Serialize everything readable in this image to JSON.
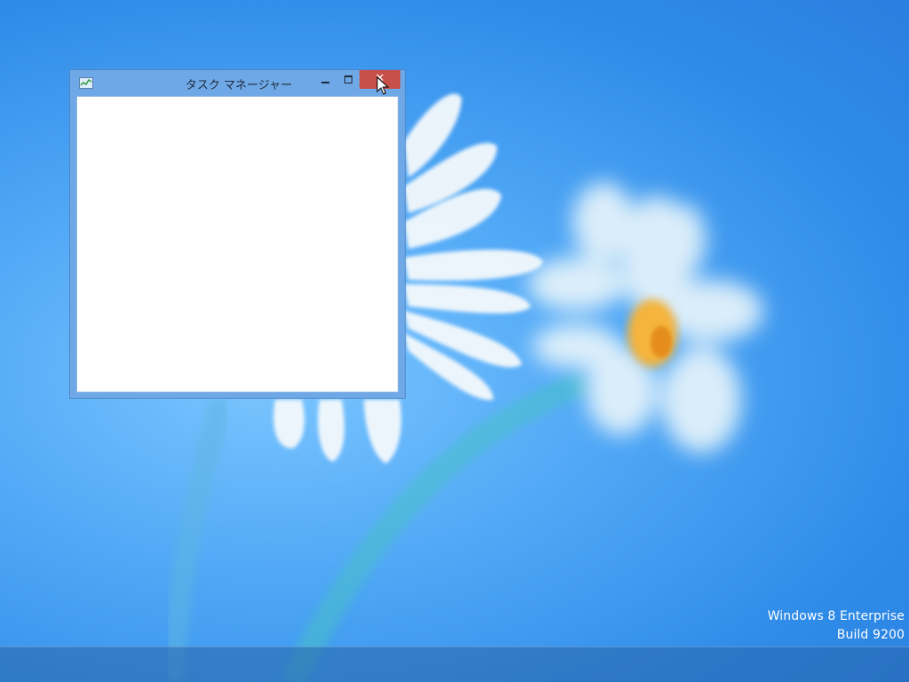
{
  "desktop": {
    "watermark_line1": "Windows 8 Enterprise",
    "watermark_line2": "Build 9200"
  },
  "window": {
    "title": "タスク マネージャー",
    "icon": "task-manager-icon",
    "close_glyph": "✕",
    "close_color": "#c7504a",
    "frame_color": "#6fa8e6"
  },
  "colors": {
    "desktop_background": "#3a93ec",
    "taskbar": "#3a6ea8"
  }
}
